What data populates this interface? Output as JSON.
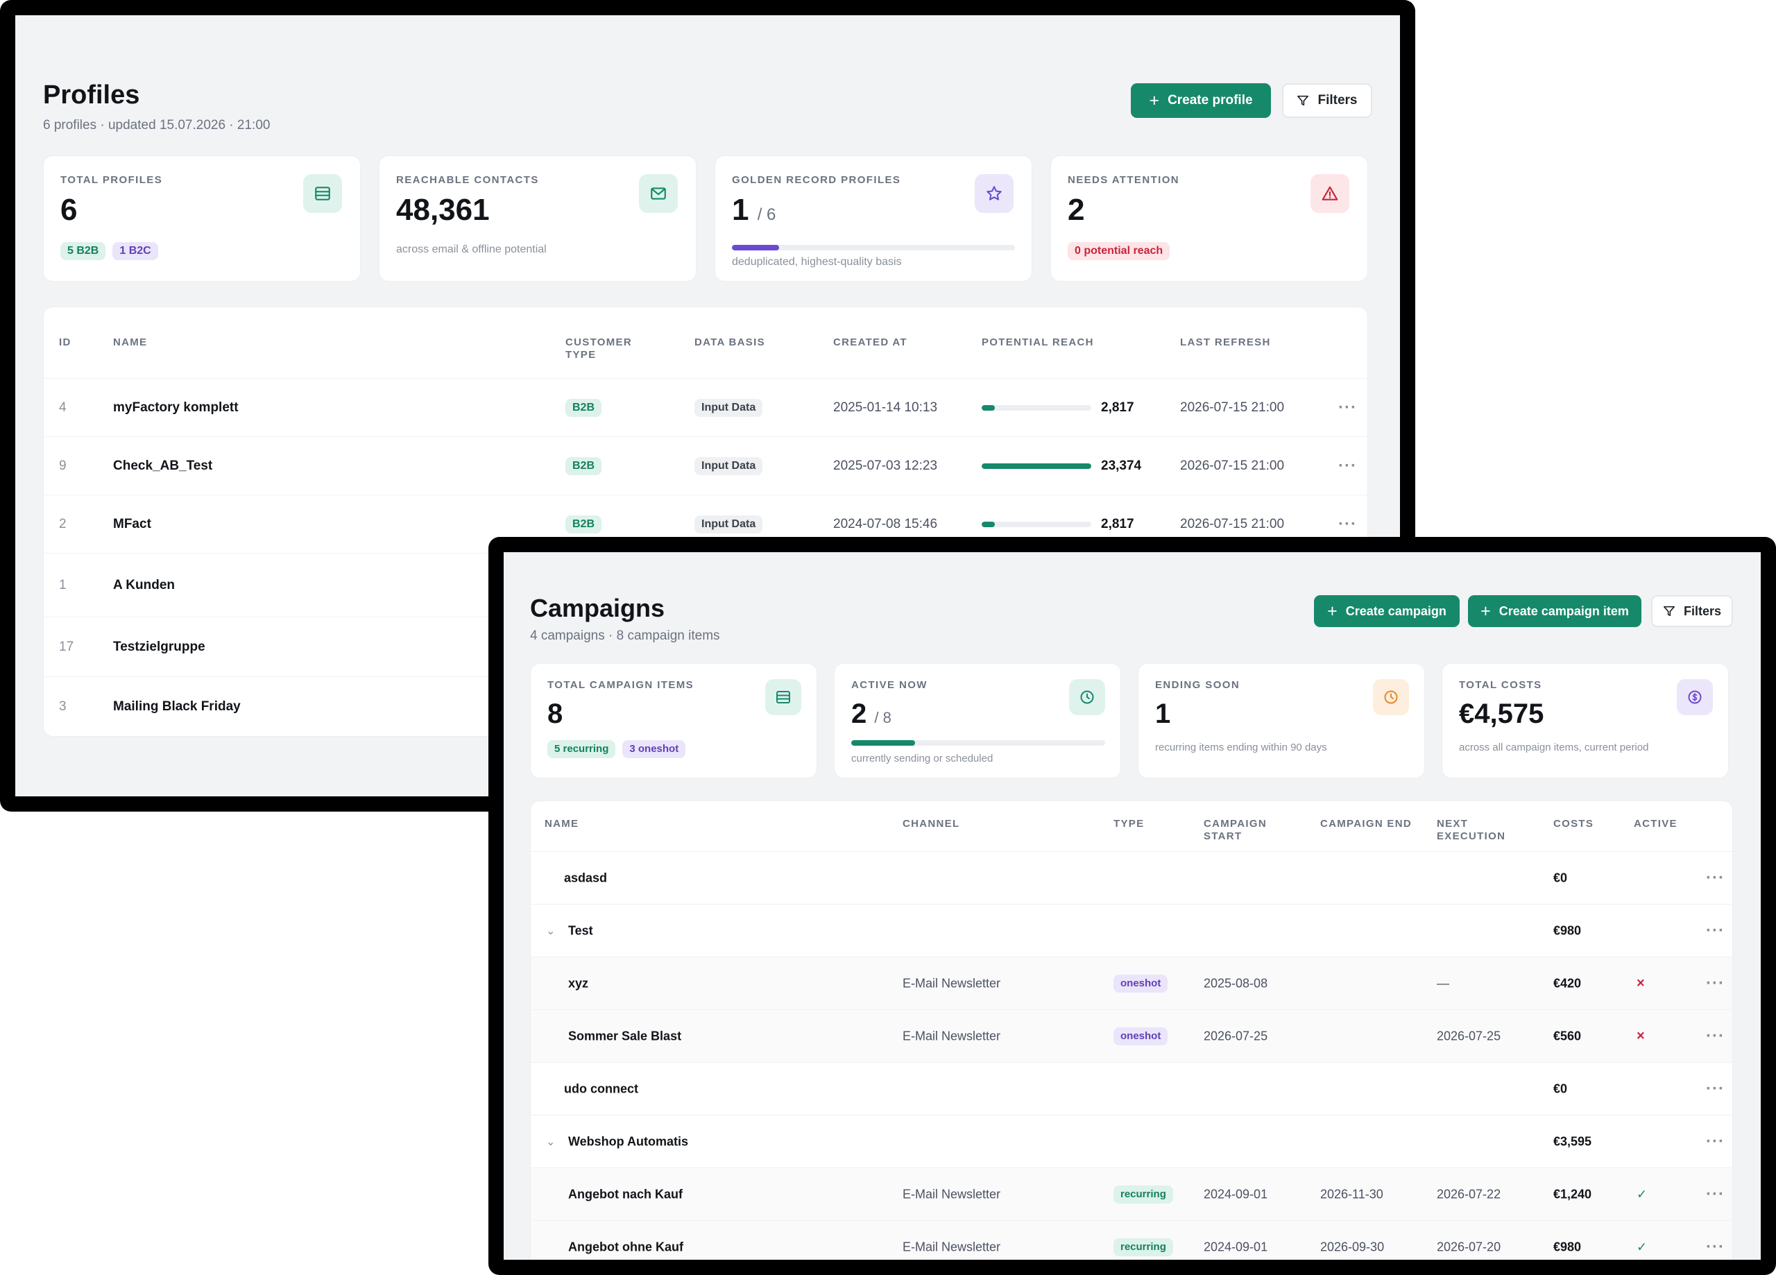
{
  "profiles": {
    "title": "Profiles",
    "subtitle": "6 profiles · updated 15.07.2026 · 21:00",
    "create_label": "Create profile",
    "filters_label": "Filters",
    "stats": {
      "total": {
        "label": "TOTAL PROFILES",
        "value": "6",
        "b2b": "5 B2B",
        "b2c": "1 B2C",
        "icon": "database-icon"
      },
      "reachable": {
        "label": "REACHABLE CONTACTS",
        "value": "48,361",
        "note": "across email & offline potential",
        "icon": "mail-icon"
      },
      "golden": {
        "label": "GOLDEN RECORD PROFILES",
        "value": "1",
        "of": "/ 6",
        "progress": 0.167,
        "note": "deduplicated, highest-quality basis",
        "icon": "star-icon"
      },
      "attention": {
        "label": "NEEDS ATTENTION",
        "value": "2",
        "badge": "0 potential reach",
        "icon": "warning-icon"
      }
    },
    "columns": [
      "ID",
      "NAME",
      "CUSTOMER\nTYPE",
      "DATA BASIS",
      "CREATED AT",
      "POTENTIAL REACH",
      "LAST REFRESH"
    ],
    "rows": [
      {
        "id": "4",
        "name": "myFactory komplett",
        "type": "B2B",
        "basis": "Input Data",
        "created": "2025-01-14 10:13",
        "reach": "2,817",
        "reach_frac": 0.12,
        "refresh": "2026-07-15 21:00"
      },
      {
        "id": "9",
        "name": "Check_AB_Test",
        "type": "B2B",
        "basis": "Input Data",
        "created": "2025-07-03 12:23",
        "reach": "23,374",
        "reach_frac": 1.0,
        "refresh": "2026-07-15 21:00"
      },
      {
        "id": "2",
        "name": "MFact",
        "type": "B2B",
        "basis": "Input Data",
        "created": "2024-07-08 15:46",
        "reach": "2,817",
        "reach_frac": 0.12,
        "refresh": "2026-07-15 21:00"
      },
      {
        "id": "1",
        "name": "A Kunden"
      },
      {
        "id": "17",
        "name": "Testzielgruppe"
      },
      {
        "id": "3",
        "name": "Mailing Black Friday"
      }
    ]
  },
  "campaigns": {
    "title": "Campaigns",
    "subtitle": "4 campaigns · 8 campaign items",
    "create_campaign_label": "Create campaign",
    "create_item_label": "Create campaign item",
    "filters_label": "Filters",
    "stats": {
      "items": {
        "label": "TOTAL CAMPAIGN ITEMS",
        "value": "8",
        "recurring": "5 recurring",
        "oneshot": "3 oneshot",
        "icon": "database-icon"
      },
      "active": {
        "label": "ACTIVE NOW",
        "value": "2",
        "of": "/ 8",
        "progress": 0.25,
        "note": "currently sending or scheduled",
        "icon": "clock-icon"
      },
      "ending": {
        "label": "ENDING SOON",
        "value": "1",
        "note": "recurring items ending within 90 days",
        "icon": "clock-icon"
      },
      "costs": {
        "label": "TOTAL COSTS",
        "value": "€4,575",
        "note": "across all campaign items, current period",
        "icon": "coin-icon"
      }
    },
    "columns": [
      "NAME",
      "CHANNEL",
      "TYPE",
      "CAMPAIGN\nSTART",
      "CAMPAIGN END",
      "NEXT\nEXECUTION",
      "COSTS",
      "ACTIVE"
    ],
    "rows": [
      {
        "name": "asdasd",
        "costs": "€0"
      },
      {
        "name": "Test",
        "costs": "€980",
        "expanded": true
      },
      {
        "name": "xyz",
        "channel": "E-Mail Newsletter",
        "type": "oneshot",
        "start": "2025-08-08",
        "end": "",
        "next": "—",
        "costs": "€420",
        "active": "×"
      },
      {
        "name": "Sommer Sale Blast",
        "channel": "E-Mail Newsletter",
        "type": "oneshot",
        "start": "2026-07-25",
        "end": "",
        "next": "2026-07-25",
        "costs": "€560",
        "active": "×"
      },
      {
        "name": "udo connect",
        "costs": "€0"
      },
      {
        "name": "Webshop Automatis",
        "costs": "€3,595",
        "expanded": true
      },
      {
        "name": "Angebot nach Kauf",
        "channel": "E-Mail Newsletter",
        "type": "recurring",
        "start": "2024-09-01",
        "end": "2026-11-30",
        "next": "2026-07-22",
        "costs": "€1,240",
        "active": "✓"
      },
      {
        "name": "Angebot ohne Kauf",
        "channel": "E-Mail Newsletter",
        "type": "recurring",
        "start": "2024-09-01",
        "end": "2026-09-30",
        "next": "2026-07-20",
        "costs": "€980",
        "active": "✓"
      }
    ]
  },
  "colors": {
    "accent": "#16896b",
    "violet": "#6a4bd0",
    "danger": "#c8253a",
    "warning": "#e38a2c"
  }
}
